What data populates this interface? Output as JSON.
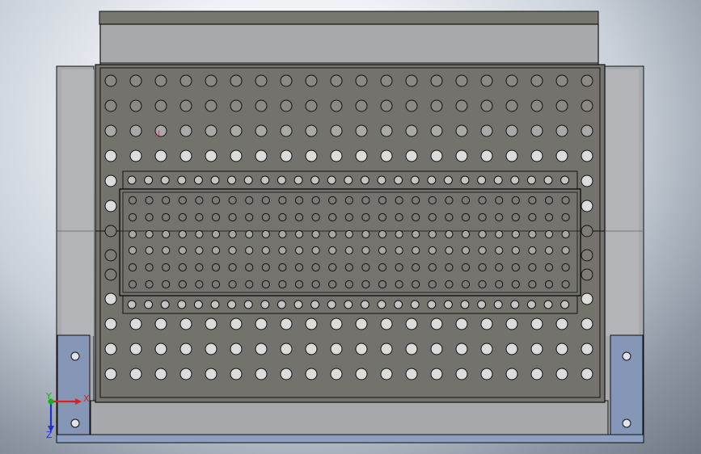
{
  "viewport": {
    "colors": {
      "background_center": "#ffffff",
      "background_edge": "#6f7884",
      "body_face": "#74736e",
      "frame_grey": "#a8a9ab",
      "bracket_blue": "#8496b6",
      "edge_black": "#111111",
      "hole_fill_dark": "#6a6965",
      "hole_fill_light": "#d9d9d9"
    }
  },
  "triad": {
    "x_label": "X",
    "y_label": "Y",
    "z_label": "Z",
    "x_color": "#e02020",
    "y_color": "#18b018",
    "z_color": "#2030d8"
  },
  "icons": {
    "mounting_bracket": "bracket-icon",
    "coordinate_triad": "triad-icon"
  }
}
